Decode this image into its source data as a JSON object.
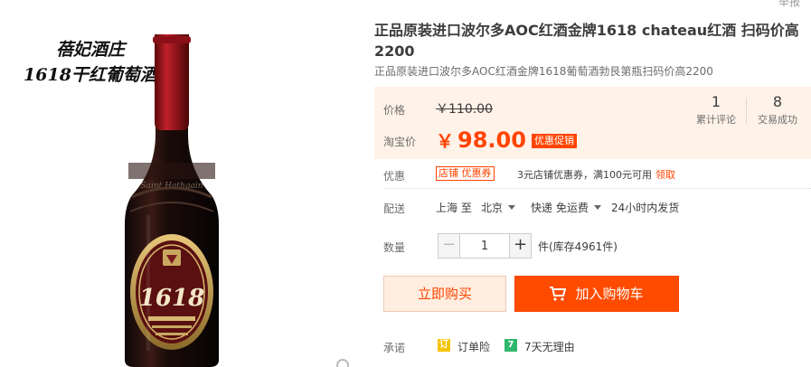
{
  "image": {
    "promo_line_1": "蓓妃酒庄",
    "promo_line_2": "1618干红葡萄酒",
    "label_number": "1618"
  },
  "top_link": "举报",
  "product": {
    "title": "正品原装进口波尔多AOC红酒金牌1618 chateau红酒 扫码价高2200",
    "subtitle": "正品原装进口波尔多AOC红酒金牌1618葡萄酒勃艮第瓶扫码价高2200"
  },
  "price": {
    "label": "价格",
    "old": "￥110.00",
    "promo_label": "淘宝价",
    "currency": "￥",
    "new": "98.00",
    "tag": "优惠促销"
  },
  "stats": [
    {
      "num": "1",
      "caption": "累计评论"
    },
    {
      "num": "8",
      "caption": "交易成功"
    }
  ],
  "discount": {
    "label": "优惠",
    "tag": "店铺 优惠券",
    "text": "3元店铺优惠券，满100元可用",
    "link": "领取"
  },
  "shipping": {
    "label": "配送",
    "from": "上海 至",
    "to": "北京",
    "method": "快递 免运费",
    "delivery": "24小时内发货"
  },
  "quantity": {
    "label": "数量",
    "minus": "−",
    "value": "1",
    "plus": "+",
    "stock": "件(库存4961件)"
  },
  "buttons": {
    "buy": "立即购买",
    "cart": "加入购物车"
  },
  "promise": {
    "label": "承诺",
    "items": [
      {
        "icon": "订",
        "text": "订单险"
      },
      {
        "icon": "7",
        "text": "7天无理由"
      }
    ]
  },
  "colors": {
    "accent": "#ff4400",
    "price_bg": "#fff2e8"
  }
}
